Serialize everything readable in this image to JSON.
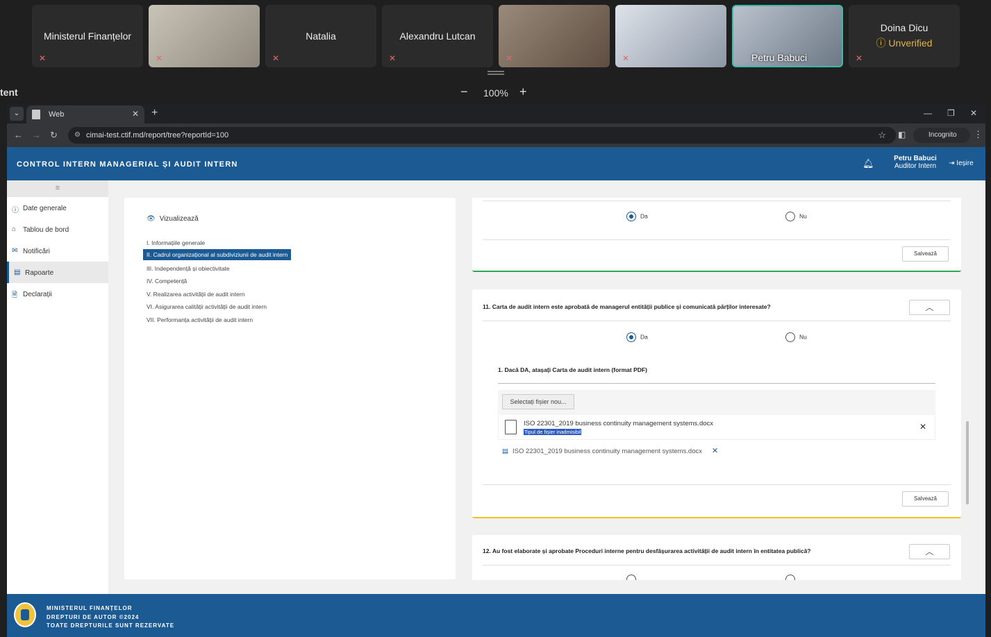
{
  "meeting": {
    "participants": [
      {
        "name": "Ministerul Finanțelor",
        "video": false
      },
      {
        "name": "",
        "video": true
      },
      {
        "name": "Natalia",
        "video": false
      },
      {
        "name": "Alexandru Lutcan",
        "video": false
      },
      {
        "name": "",
        "video": true
      },
      {
        "name": "",
        "video": true
      },
      {
        "name": "Petru Babuci",
        "video": true,
        "active": true
      },
      {
        "name": "Doina Dicu",
        "status": "Unverified",
        "video": false
      }
    ],
    "side_label": "tent",
    "zoom": "100%",
    "zoom_minus": "−",
    "zoom_plus": "+"
  },
  "browser": {
    "tab_title": "Web",
    "url": "cimai-test.ctif.md/report/tree?reportId=100",
    "incognito": "Incognito"
  },
  "app": {
    "brand": "CONTROL INTERN MANAGERIAL ȘI AUDIT INTERN",
    "user_name": "Petru Babuci",
    "user_role": "Auditor Intern",
    "logout": "Ieșire",
    "sidebar": [
      {
        "label": "Date generale",
        "icon": "info-icon"
      },
      {
        "label": "Tablou de bord",
        "icon": "home-icon"
      },
      {
        "label": "Notificări",
        "icon": "mail-icon"
      },
      {
        "label": "Rapoarte",
        "icon": "report-icon",
        "active": true
      },
      {
        "label": "Declarații",
        "icon": "document-icon"
      }
    ],
    "tree": {
      "view_label": "Vizualizează",
      "nodes": [
        "I. Informațiile generale",
        "II. Cadrul organizațional al subdiviziunii de audit intern",
        "III. Independență și obiectivitate",
        "IV. Competență",
        "V. Realizarea activității de audit intern",
        "VI. Asigurarea calității activității de audit intern",
        "VII. Performanța activității de audit intern"
      ],
      "selected": 1
    },
    "questions": {
      "prev": {
        "yes": "Da",
        "no": "Nu",
        "save": "Salvează"
      },
      "q11": {
        "text": "11. Carta de audit intern este aprobată de managerul entității publice și comunicată părților interesate?",
        "yes": "Da",
        "no": "Nu",
        "sub_question": "1. Dacă DA, atașați Carta de audit intern (format PDF)",
        "select_file": "Selectați fișier nou...",
        "file_name": "ISO 22301_2019 business continuity management systems.docx",
        "file_error": "Tipul de fișier inadmisibil",
        "attached_file": "ISO 22301_2019 business continuity management systems.docx",
        "save": "Salvează"
      },
      "q12": {
        "text": "12. Au fost elaborate și aprobate Proceduri interne pentru desfășurarea activității de audit intern în entitatea publică?"
      }
    },
    "footer": {
      "line1": "MINISTERUL FINANȚELOR",
      "line2": "DREPTURI DE AUTOR ©2024",
      "line3": "TOATE DREPTURILE SUNT REZERVATE"
    }
  }
}
